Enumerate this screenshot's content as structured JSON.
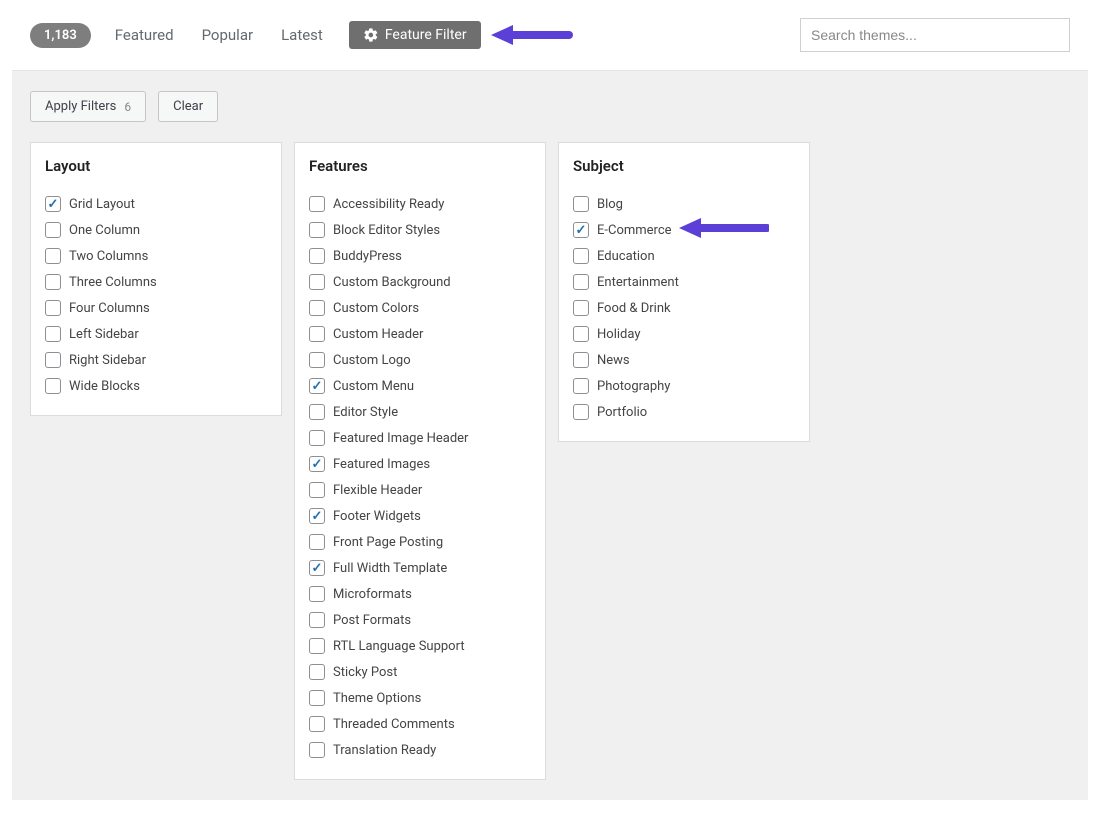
{
  "topbar": {
    "count": "1,183",
    "tabs": [
      "Featured",
      "Popular",
      "Latest"
    ],
    "feature_filter": "Feature Filter",
    "search_placeholder": "Search themes..."
  },
  "actions": {
    "apply": "Apply Filters",
    "apply_count": "6",
    "clear": "Clear"
  },
  "columns": {
    "layout": {
      "title": "Layout",
      "items": [
        {
          "label": "Grid Layout",
          "checked": true
        },
        {
          "label": "One Column",
          "checked": false
        },
        {
          "label": "Two Columns",
          "checked": false
        },
        {
          "label": "Three Columns",
          "checked": false
        },
        {
          "label": "Four Columns",
          "checked": false
        },
        {
          "label": "Left Sidebar",
          "checked": false
        },
        {
          "label": "Right Sidebar",
          "checked": false
        },
        {
          "label": "Wide Blocks",
          "checked": false
        }
      ]
    },
    "features": {
      "title": "Features",
      "items": [
        {
          "label": "Accessibility Ready",
          "checked": false
        },
        {
          "label": "Block Editor Styles",
          "checked": false
        },
        {
          "label": "BuddyPress",
          "checked": false
        },
        {
          "label": "Custom Background",
          "checked": false
        },
        {
          "label": "Custom Colors",
          "checked": false
        },
        {
          "label": "Custom Header",
          "checked": false
        },
        {
          "label": "Custom Logo",
          "checked": false
        },
        {
          "label": "Custom Menu",
          "checked": true
        },
        {
          "label": "Editor Style",
          "checked": false
        },
        {
          "label": "Featured Image Header",
          "checked": false
        },
        {
          "label": "Featured Images",
          "checked": true
        },
        {
          "label": "Flexible Header",
          "checked": false
        },
        {
          "label": "Footer Widgets",
          "checked": true
        },
        {
          "label": "Front Page Posting",
          "checked": false
        },
        {
          "label": "Full Width Template",
          "checked": true
        },
        {
          "label": "Microformats",
          "checked": false
        },
        {
          "label": "Post Formats",
          "checked": false
        },
        {
          "label": "RTL Language Support",
          "checked": false
        },
        {
          "label": "Sticky Post",
          "checked": false
        },
        {
          "label": "Theme Options",
          "checked": false
        },
        {
          "label": "Threaded Comments",
          "checked": false
        },
        {
          "label": "Translation Ready",
          "checked": false
        }
      ]
    },
    "subject": {
      "title": "Subject",
      "items": [
        {
          "label": "Blog",
          "checked": false
        },
        {
          "label": "E-Commerce",
          "checked": true,
          "arrow": true
        },
        {
          "label": "Education",
          "checked": false
        },
        {
          "label": "Entertainment",
          "checked": false
        },
        {
          "label": "Food & Drink",
          "checked": false
        },
        {
          "label": "Holiday",
          "checked": false
        },
        {
          "label": "News",
          "checked": false
        },
        {
          "label": "Photography",
          "checked": false
        },
        {
          "label": "Portfolio",
          "checked": false
        }
      ]
    }
  },
  "colors": {
    "arrow": "#5b3fd6"
  }
}
